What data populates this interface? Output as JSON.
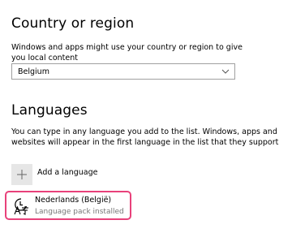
{
  "country": {
    "title": "Country or region",
    "description": "Windows and apps might use your country or region to give you local content",
    "selected": "Belgium"
  },
  "languages": {
    "title": "Languages",
    "description": "You can type in any language you add to the list. Windows, apps and websites will appear in the first language in the list that they support",
    "add_label": "Add a language",
    "items": [
      {
        "name": "Nederlands (België)",
        "status": "Language pack installed",
        "icon": "language-time-icon"
      }
    ]
  },
  "colors": {
    "highlight": "#e8417a",
    "secondary_text": "#767676",
    "button_bg": "#e6e6e6"
  }
}
